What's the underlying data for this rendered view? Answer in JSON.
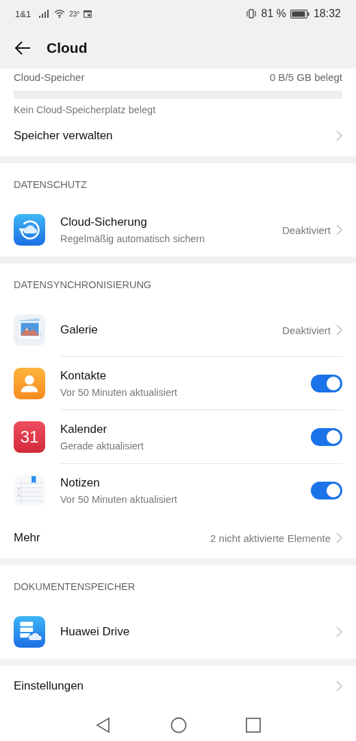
{
  "status_bar": {
    "carrier": "1&1",
    "temperature": "23°",
    "battery": "81 %",
    "time": "18:32"
  },
  "header": {
    "title": "Cloud"
  },
  "storage": {
    "label": "Cloud-Speicher",
    "value": "0 B/5 GB belegt",
    "level": 0,
    "note": "Kein Cloud-Speicherplatz belegt",
    "manage": "Speicher verwalten"
  },
  "sections": [
    {
      "title": "DATENSCHUTZ",
      "items": [
        {
          "kind": "link",
          "title": "Cloud-Sicherung",
          "subtitle": "Regelmäßig automatisch sichern",
          "value": "Deaktiviert"
        }
      ]
    },
    {
      "title": "DATENSYNCHRONISIERUNG",
      "items": [
        {
          "kind": "link",
          "title": "Galerie",
          "value": "Deaktiviert"
        },
        {
          "kind": "toggle",
          "title": "Kontakte",
          "subtitle": "Vor 50 Minuten aktualisiert",
          "on": true
        },
        {
          "kind": "toggle",
          "title": "Kalender",
          "subtitle": "Gerade aktualisiert",
          "on": true
        },
        {
          "kind": "toggle",
          "title": "Notizen",
          "subtitle": "Vor 50 Minuten aktualisiert",
          "on": true
        },
        {
          "kind": "more",
          "title": "Mehr",
          "value": "2 nicht aktivierte Elemente"
        }
      ]
    },
    {
      "title": "DOKUMENTENSPEICHER",
      "items": [
        {
          "kind": "link",
          "title": "Huawei Drive"
        }
      ]
    }
  ],
  "settings": {
    "title": "Einstellungen"
  },
  "calendar_icon_day": "31"
}
